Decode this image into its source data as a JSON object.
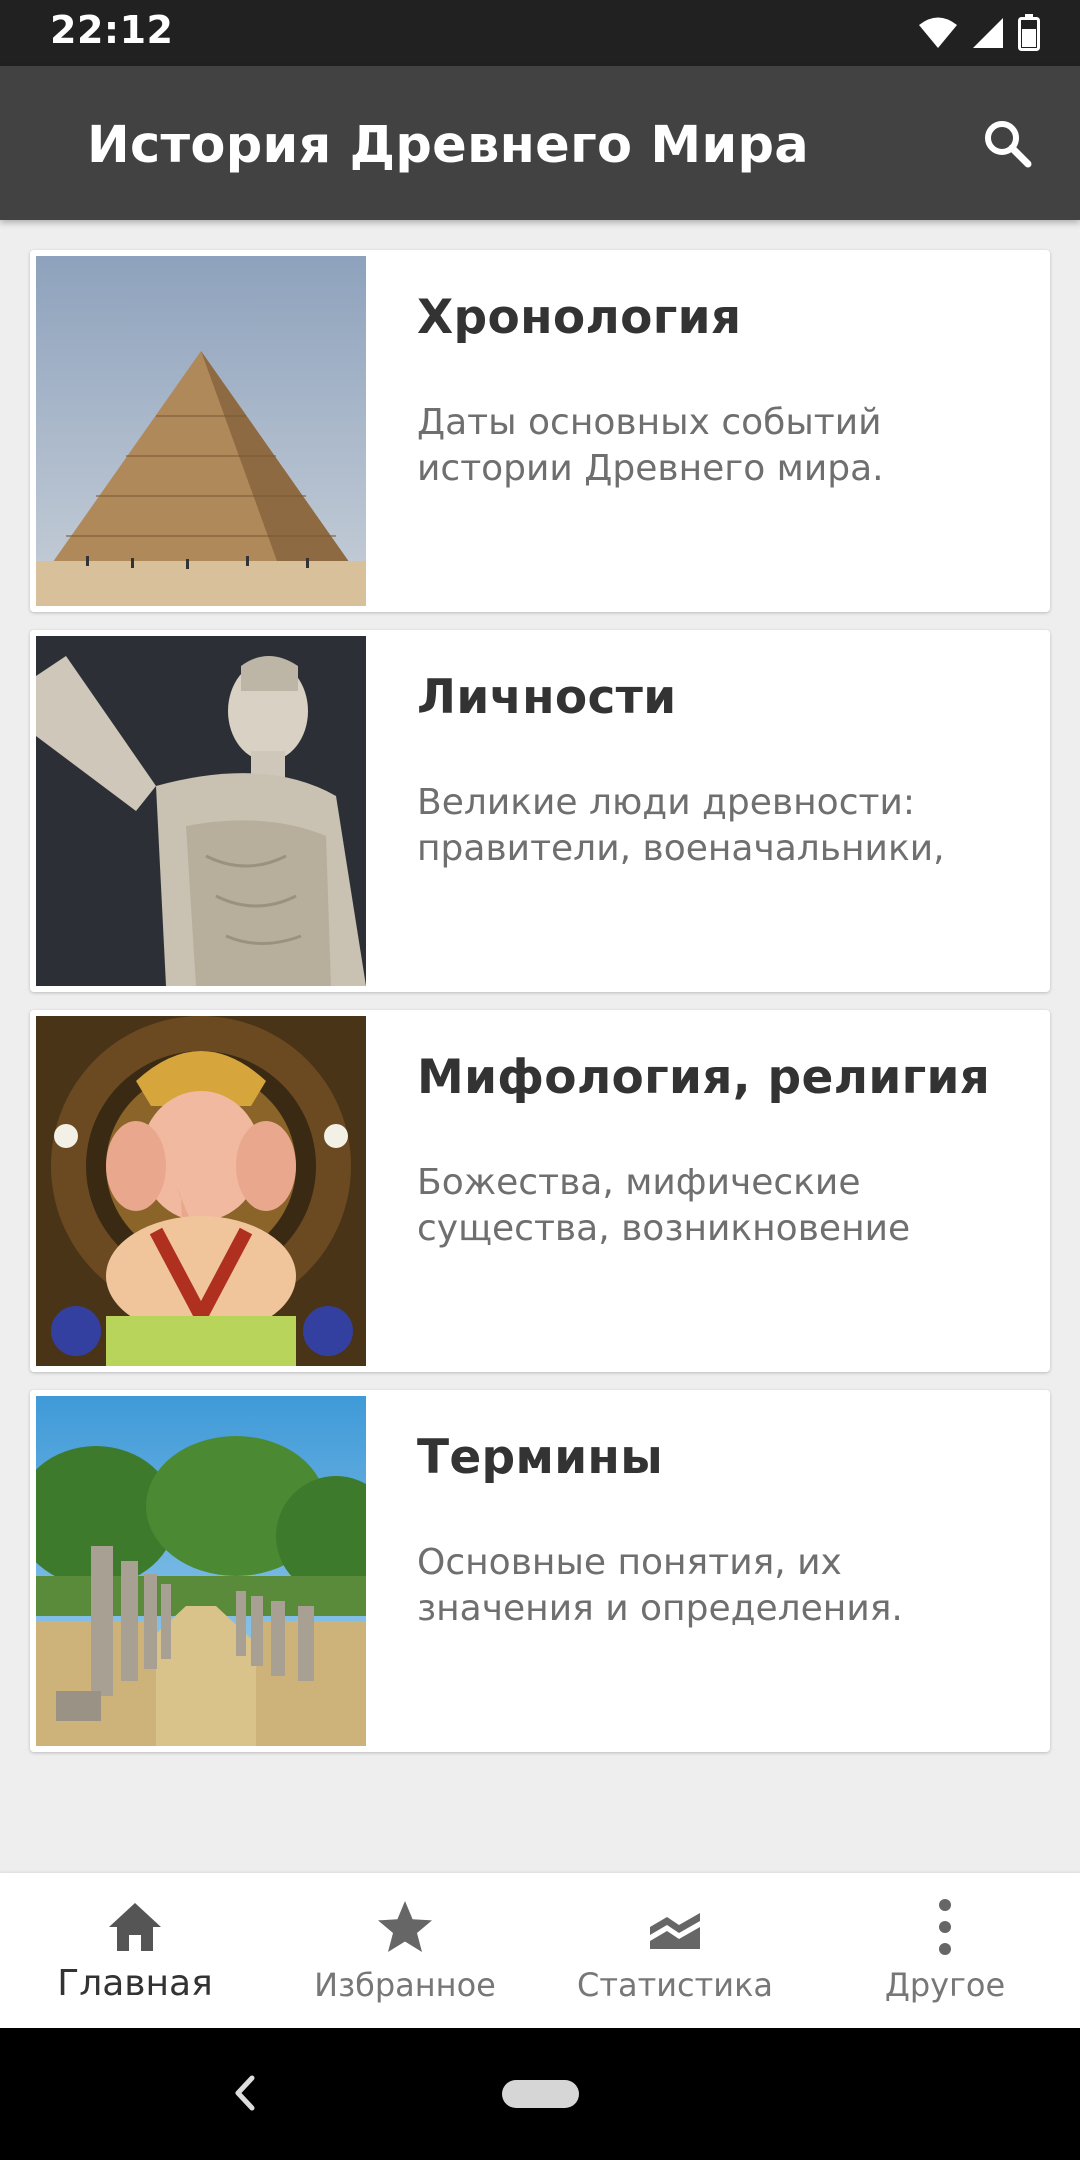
{
  "status_bar": {
    "time": "22:12",
    "icons": [
      "wifi-icon",
      "signal-icon",
      "battery-icon"
    ]
  },
  "app_bar": {
    "title": "История Древнего Мира",
    "search_icon": "search-icon"
  },
  "cards": [
    {
      "title": "Хронология",
      "description": "Даты основных событий истории Древнего мира.",
      "image": "pyramid"
    },
    {
      "title": "Личности",
      "description": "Великие люди древности: правители, военачальники,",
      "image": "statue"
    },
    {
      "title": "Мифология, религия",
      "description": "Божества, мифические существа, возникновение",
      "image": "deity"
    },
    {
      "title": "Термины",
      "description": "Основные понятия, их значения и определения.",
      "image": "columns"
    }
  ],
  "bottom_nav": {
    "items": [
      {
        "label": "Главная",
        "icon": "home-icon",
        "active": true
      },
      {
        "label": "Избранное",
        "icon": "star-icon",
        "active": false
      },
      {
        "label": "Статистика",
        "icon": "chart-icon",
        "active": false
      },
      {
        "label": "Другое",
        "icon": "more-vert-icon",
        "active": false
      }
    ]
  },
  "colors": {
    "status_bar": "#212121",
    "app_bar": "#424242",
    "background": "#eeeeee",
    "card": "#ffffff",
    "nav_icon": "#555555"
  }
}
